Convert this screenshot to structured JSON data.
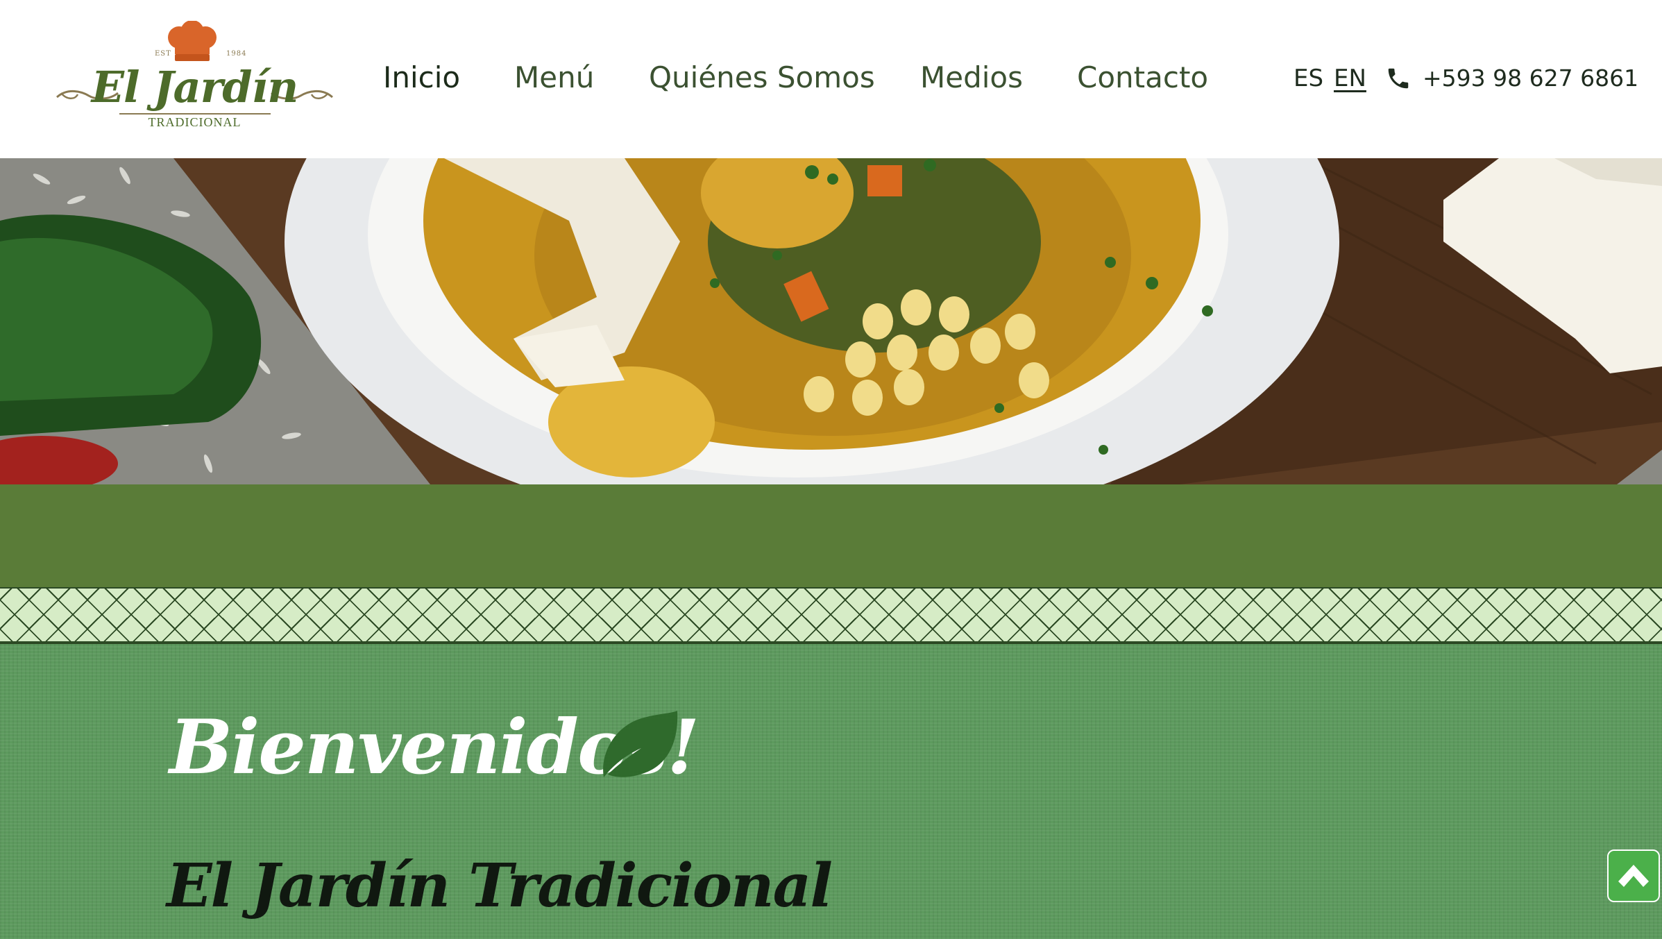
{
  "header": {
    "logo": {
      "name": "El Jardín",
      "subtitle": "TRADICIONAL",
      "est": "EST",
      "year": "1984"
    },
    "nav": [
      {
        "label": "Inicio",
        "active": true
      },
      {
        "label": "Menú",
        "active": false
      },
      {
        "label": "Quiénes Somos",
        "active": false
      },
      {
        "label": "Medios",
        "active": false
      },
      {
        "label": "Contacto",
        "active": false
      }
    ],
    "languages": {
      "es": "ES",
      "en": "EN",
      "selected": "EN"
    },
    "phone": "+593 98 627 6861",
    "phone_icon": "phone-icon"
  },
  "hero": {
    "image": "dish-photo"
  },
  "welcome": {
    "heading": "Bienvenidos!",
    "subheading": "El Jardín Tradicional",
    "icon": "leaf-icon"
  },
  "scroll_top": {
    "icon": "chevron-up-icon"
  },
  "colors": {
    "brand_green": "#5a7c38",
    "content_green": "#5d9a5e",
    "pattern_bg": "#d6ecc6",
    "accent_button": "#4bb04a",
    "hat_orange": "#d9652a"
  }
}
